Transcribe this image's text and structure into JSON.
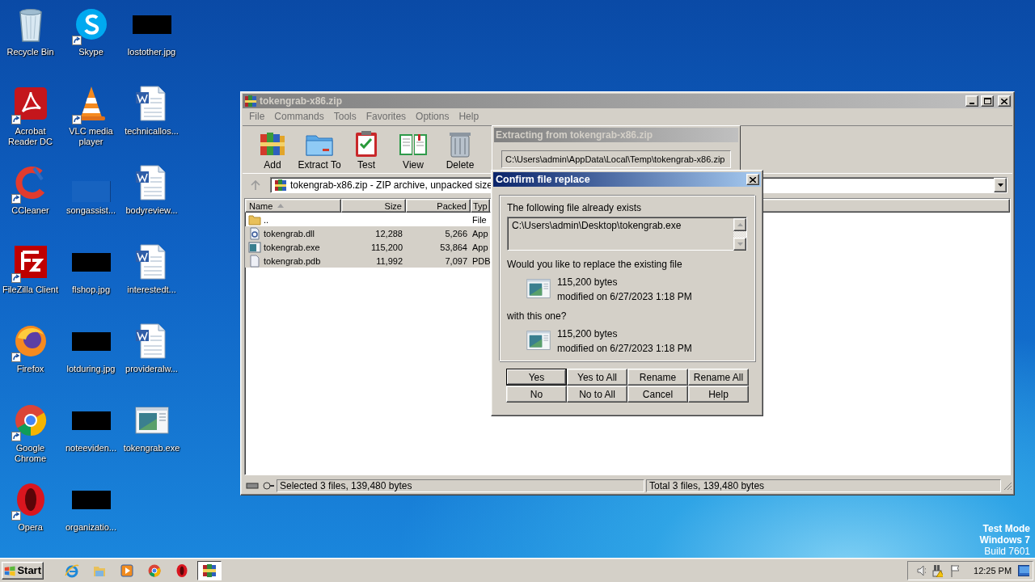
{
  "desktop_icons": [
    {
      "label": "Recycle Bin",
      "kind": "recycle-bin",
      "shortcut": false
    },
    {
      "label": "Acrobat Reader DC",
      "kind": "acrobat",
      "shortcut": true
    },
    {
      "label": "CCleaner",
      "kind": "ccleaner",
      "shortcut": true
    },
    {
      "label": "FileZilla Client",
      "kind": "filezilla",
      "shortcut": true
    },
    {
      "label": "Firefox",
      "kind": "firefox",
      "shortcut": true
    },
    {
      "label": "Google Chrome",
      "kind": "chrome",
      "shortcut": true
    },
    {
      "label": "Opera",
      "kind": "opera",
      "shortcut": true
    },
    {
      "label": "Skype",
      "kind": "skype",
      "shortcut": true
    },
    {
      "label": "VLC media player",
      "kind": "vlc",
      "shortcut": true
    },
    {
      "label": "songassist...",
      "kind": "image-blank",
      "shortcut": false
    },
    {
      "label": "flshop.jpg",
      "kind": "image",
      "shortcut": false
    },
    {
      "label": "lotduring.jpg",
      "kind": "image",
      "shortcut": false
    },
    {
      "label": "noteeviden...",
      "kind": "image",
      "shortcut": false
    },
    {
      "label": "organizatio...",
      "kind": "image",
      "shortcut": false
    },
    {
      "label": "lostother.jpg",
      "kind": "image",
      "shortcut": false
    },
    {
      "label": "technicallos...",
      "kind": "word",
      "shortcut": false
    },
    {
      "label": "bodyreview...",
      "kind": "word",
      "shortcut": false
    },
    {
      "label": "interestedt...",
      "kind": "word",
      "shortcut": false
    },
    {
      "label": "provideralw...",
      "kind": "word",
      "shortcut": false
    },
    {
      "label": "tokengrab.exe",
      "kind": "exe",
      "shortcut": false
    }
  ],
  "archive_window": {
    "title": "tokengrab-x86.zip",
    "menu": [
      "File",
      "Commands",
      "Tools",
      "Favorites",
      "Options",
      "Help"
    ],
    "toolbar": [
      {
        "label": "Add",
        "kind": "add"
      },
      {
        "label": "Extract To",
        "kind": "extract"
      },
      {
        "label": "Test",
        "kind": "test"
      },
      {
        "label": "View",
        "kind": "view"
      },
      {
        "label": "Delete",
        "kind": "delete"
      }
    ],
    "address": "tokengrab-x86.zip - ZIP archive, unpacked size",
    "columns": [
      "Name",
      "Size",
      "Packed",
      "Typ"
    ],
    "rows": [
      {
        "name": "..",
        "type": "File",
        "kind": "folder",
        "selected": false
      },
      {
        "name": "tokengrab.dll",
        "size": "12,288",
        "packed": "5,266",
        "type": "App",
        "kind": "dll",
        "selected": true
      },
      {
        "name": "tokengrab.exe",
        "size": "115,200",
        "packed": "53,864",
        "type": "App",
        "kind": "exe",
        "selected": true
      },
      {
        "name": "tokengrab.pdb",
        "size": "11,992",
        "packed": "7,097",
        "type": "PDB",
        "kind": "file",
        "selected": true
      }
    ],
    "status_bar": [
      "Selected 3 files, 139,480 bytes",
      "Total 3 files, 139,480 bytes"
    ]
  },
  "extract_dialog": {
    "title": "Extracting from tokengrab-x86.zip",
    "path": "C:\\Users\\admin\\AppData\\Local\\Temp\\tokengrab-x86.zip"
  },
  "confirm_dialog": {
    "title": "Confirm file replace",
    "existing_label": "The following file already exists",
    "existing_path": "C:\\Users\\admin\\Desktop\\tokengrab.exe",
    "question": "Would you like to replace the existing file",
    "existing_file": {
      "size": "115,200 bytes",
      "modified": "modified on 6/27/2023 1:18 PM"
    },
    "with_label": "with this one?",
    "new_file": {
      "size": "115,200 bytes",
      "modified": "modified on 6/27/2023 1:18 PM"
    },
    "buttons": [
      {
        "label": "Yes",
        "selected": true
      },
      {
        "label": "Yes to All",
        "selected": false
      },
      {
        "label": "Rename",
        "selected": false
      },
      {
        "label": "Rename All",
        "selected": false
      },
      {
        "label": "No",
        "selected": false
      },
      {
        "label": "No to All",
        "selected": false
      },
      {
        "label": "Cancel",
        "selected": false
      },
      {
        "label": "Help",
        "selected": false
      }
    ]
  },
  "system_notice": [
    "Test Mode",
    "Windows 7",
    "Build 7601"
  ],
  "taskbar": {
    "start": "Start",
    "items": [
      {
        "kind": "ie",
        "selected": false
      },
      {
        "kind": "folder",
        "selected": false
      },
      {
        "kind": "media",
        "selected": false
      },
      {
        "kind": "chrome",
        "selected": false
      },
      {
        "kind": "opera",
        "selected": false
      },
      {
        "kind": "archive",
        "selected": true
      }
    ],
    "clock": "12:25 PM"
  }
}
